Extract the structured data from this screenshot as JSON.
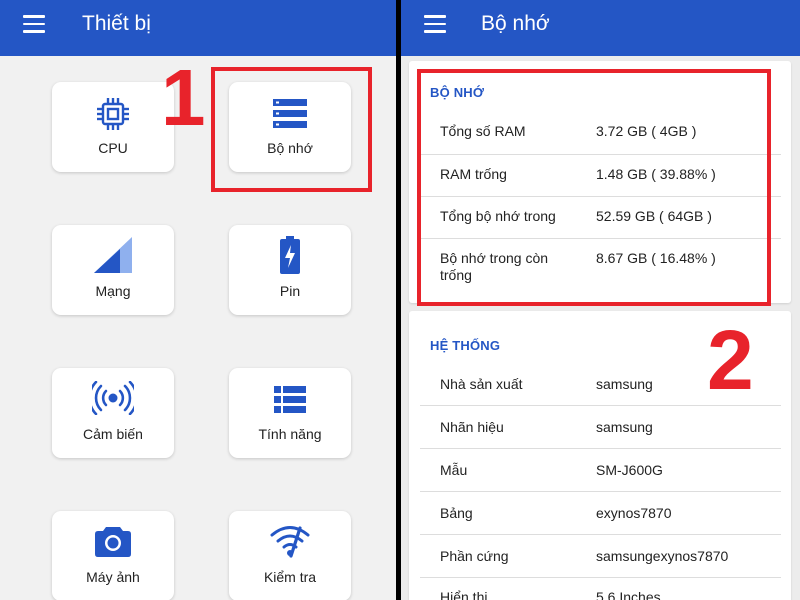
{
  "left": {
    "title": "Thiết bị",
    "tiles": [
      {
        "label": "CPU",
        "icon": "cpu-icon"
      },
      {
        "label": "Bộ nhớ",
        "icon": "memory-icon"
      },
      {
        "label": "Mạng",
        "icon": "signal-icon"
      },
      {
        "label": "Pin",
        "icon": "battery-icon"
      },
      {
        "label": "Cảm biến",
        "icon": "sensor-icon"
      },
      {
        "label": "Tính năng",
        "icon": "features-icon"
      },
      {
        "label": "Máy ảnh",
        "icon": "camera-icon"
      },
      {
        "label": "Kiểm tra",
        "icon": "wifi-test-icon"
      }
    ],
    "annotation_number": "1"
  },
  "right": {
    "title": "Bộ nhớ",
    "memory": {
      "heading": "BỘ NHỚ",
      "rows": [
        {
          "key": "Tổng số RAM",
          "value": "3.72 GB ( 4GB )"
        },
        {
          "key": "RAM trống",
          "value": "1.48 GB ( 39.88% )"
        },
        {
          "key": "Tổng bộ nhớ trong",
          "value": "52.59 GB ( 64GB )"
        },
        {
          "key": "Bộ nhớ trong còn trống",
          "value": "8.67 GB ( 16.48% )"
        }
      ]
    },
    "system": {
      "heading": "HỆ THỐNG",
      "rows": [
        {
          "key": "Nhà sản xuất",
          "value": "samsung"
        },
        {
          "key": "Nhãn hiệu",
          "value": "samsung"
        },
        {
          "key": "Mẫu",
          "value": "SM-J600G"
        },
        {
          "key": "Bảng",
          "value": "exynos7870"
        },
        {
          "key": "Phần cứng",
          "value": "samsungexynos7870"
        },
        {
          "key": "Hiển thị",
          "value": "5.6 Inches"
        }
      ]
    },
    "annotation_number": "2"
  },
  "colors": {
    "appbar": "#2456c5",
    "accent": "#2456c5",
    "annotation": "#e8232b",
    "icon_light": "#8fb0ee"
  }
}
